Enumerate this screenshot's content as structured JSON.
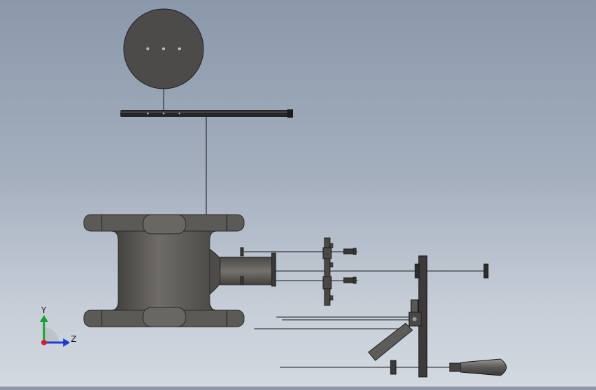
{
  "viewport": {
    "background_top": "#8a98aa",
    "background_bottom": "#d4d9e0",
    "part_color": "#5a5855",
    "part_dark": "#2a2a2a",
    "line_color": "#1a1a1a"
  },
  "triad": {
    "x_color": "#d0202a",
    "y_color": "#18a030",
    "z_color": "#1a3fd0",
    "y_label": "Y",
    "z_label": "Z"
  },
  "parts": [
    {
      "name": "handwheel-disc",
      "icon": "disc-icon"
    },
    {
      "name": "stem-rod",
      "icon": "rod-icon"
    },
    {
      "name": "valve-body",
      "icon": "valve-body-icon"
    },
    {
      "name": "bonnet-gland",
      "icon": "gland-icon"
    },
    {
      "name": "bracket-plate",
      "icon": "bracket-icon"
    },
    {
      "name": "lever-assembly",
      "icon": "lever-icon"
    },
    {
      "name": "handle-grip",
      "icon": "handle-icon"
    }
  ]
}
